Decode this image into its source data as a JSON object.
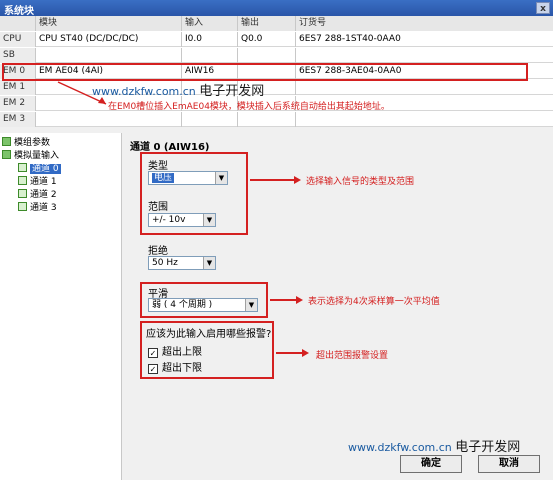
{
  "window": {
    "title": "系统块",
    "close_glyph": "x"
  },
  "table": {
    "headers": [
      "",
      "模块",
      "输入",
      "输出",
      "订货号"
    ],
    "rows": [
      {
        "slot": "CPU",
        "module": "CPU ST40 (DC/DC/DC)",
        "input": "I0.0",
        "output": "Q0.0",
        "order": "6ES7 288-1ST40-0AA0"
      },
      {
        "slot": "SB",
        "module": "",
        "input": "",
        "output": "",
        "order": ""
      },
      {
        "slot": "EM 0",
        "module": "EM AE04 (4AI)",
        "input": "AIW16",
        "output": "",
        "order": "6ES7 288-3AE04-0AA0"
      },
      {
        "slot": "EM 1",
        "module": "",
        "input": "",
        "output": "",
        "order": ""
      },
      {
        "slot": "EM 2",
        "module": "",
        "input": "",
        "output": "",
        "order": ""
      },
      {
        "slot": "EM 3",
        "module": "",
        "input": "",
        "output": "",
        "order": ""
      }
    ]
  },
  "watermark_top": {
    "url": "www.dzkfw.com.cn",
    "name": "电子开发网"
  },
  "annotation_em0": "在EM0槽位插入EmAE04模块，模块插入后系统自动给出其起始地址。",
  "tree": {
    "items": [
      {
        "label": "模组参数"
      },
      {
        "label": "模拟量输入"
      },
      {
        "label": "通道 0"
      },
      {
        "label": "通道 1"
      },
      {
        "label": "通道 2"
      },
      {
        "label": "通道 3"
      }
    ]
  },
  "channel": {
    "title": "通道 0 (AIW16)",
    "type_label": "类型",
    "type_value": "电压",
    "range_label": "范围",
    "range_value": "+/- 10v",
    "reject_label": "拒绝",
    "reject_value": "50 Hz",
    "smooth_label": "平滑",
    "smooth_value": "弱 ( 4 个周期 )",
    "alarm_question": "应该为此输入启用哪些报警?",
    "upper_label": "超出上限",
    "lower_label": "超出下限"
  },
  "annotations": {
    "type_range": "选择输入信号的类型及范围",
    "smooth": "表示选择为4次采样算一次平均值",
    "alarm": "超出范围报警设置"
  },
  "watermark_bottom": {
    "url": "www.dzkfw.com.cn",
    "name": "电子开发网"
  },
  "buttons": {
    "ok": "确定",
    "cancel": "取消"
  },
  "colors": {
    "annotation": "#d42020",
    "selection": "#316ac5",
    "title_bar": "#2a55a8"
  }
}
